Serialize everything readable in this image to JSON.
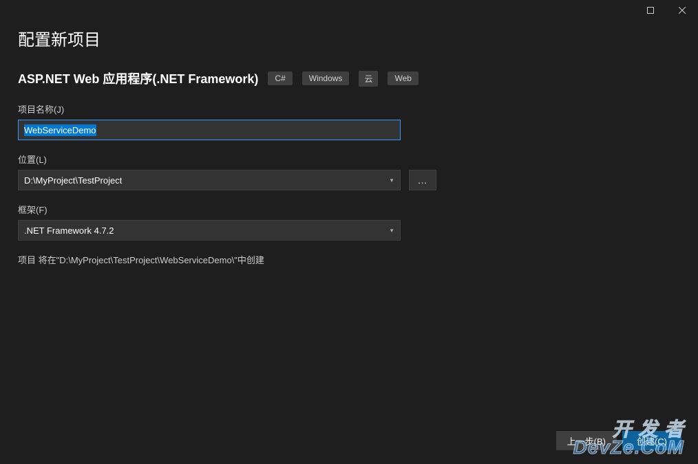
{
  "window": {
    "title": "配置新项目"
  },
  "template": {
    "name": "ASP.NET Web 应用程序(.NET Framework)",
    "tags": [
      "C#",
      "Windows",
      "云",
      "Web"
    ]
  },
  "fields": {
    "projectName": {
      "label": "项目名称(J)",
      "value": "WebServiceDemo"
    },
    "location": {
      "label": "位置(L)",
      "value": "D:\\MyProject\\TestProject",
      "browseLabel": "..."
    },
    "framework": {
      "label": "框架(F)",
      "value": ".NET Framework 4.7.2"
    }
  },
  "info": "项目 将在\"D:\\MyProject\\TestProject\\WebServiceDemo\\\"中创建",
  "footer": {
    "back": "上一步(B)",
    "create": "创建(C)"
  },
  "watermark": {
    "line1": "开 发 者",
    "line2": "DevZe.CoM"
  }
}
